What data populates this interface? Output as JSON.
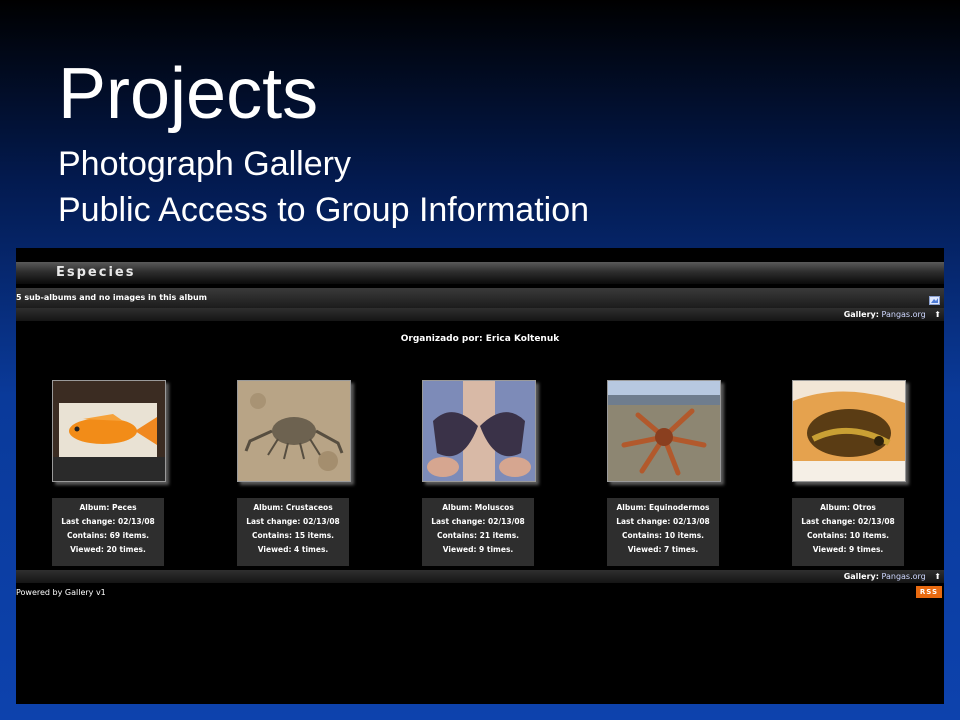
{
  "slide": {
    "title": "Projects",
    "subtitle_1": "Photograph Gallery",
    "subtitle_2": "Public Access to Group Information"
  },
  "gallery": {
    "album_title": "Especies",
    "info_text": "5 sub-albums and no images in this album",
    "breadcrumb_label": "Gallery:",
    "breadcrumb_link": "Pangas.org",
    "organizer_text": "Organizado por: Erica Koltenuk",
    "powered_by": "Powered by Gallery v1",
    "rss_label": "RSS",
    "albums": [
      {
        "name": "Album: Peces",
        "last_change": "Last change: 02/13/08",
        "contains": "Contains: 69 items.",
        "viewed": "Viewed: 20 times."
      },
      {
        "name": "Album: Crustaceos",
        "last_change": "Last change: 02/13/08",
        "contains": "Contains: 15 items.",
        "viewed": "Viewed: 4 times."
      },
      {
        "name": "Album: Moluscos",
        "last_change": "Last change: 02/13/08",
        "contains": "Contains: 21 items.",
        "viewed": "Viewed: 9 times."
      },
      {
        "name": "Album: Equinodermos",
        "last_change": "Last change: 02/13/08",
        "contains": "Contains: 10 items.",
        "viewed": "Viewed: 7 times."
      },
      {
        "name": "Album: Otros",
        "last_change": "Last change: 02/13/08",
        "contains": "Contains: 10 items.",
        "viewed": "Viewed: 9 times."
      }
    ]
  },
  "colors": {
    "slide_background": "#0a3a9a",
    "rss_badge": "#e86a10"
  }
}
